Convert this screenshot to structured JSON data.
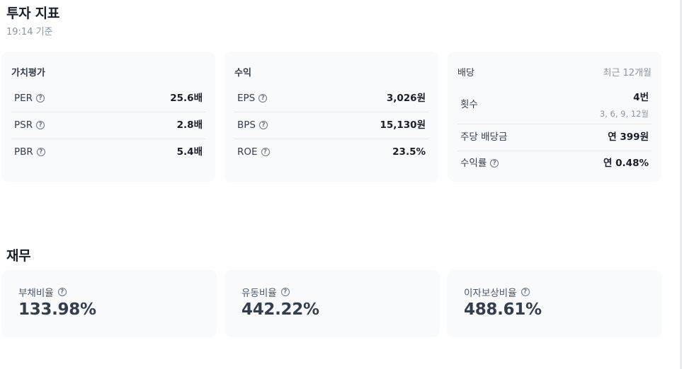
{
  "investment": {
    "title": "투자 지표",
    "timestamp": "19:14 기준"
  },
  "valuation": {
    "title": "가치평가",
    "rows": [
      {
        "label": "PER",
        "value": "25.6배"
      },
      {
        "label": "PSR",
        "value": "2.8배"
      },
      {
        "label": "PBR",
        "value": "5.4배"
      }
    ]
  },
  "profit": {
    "title": "수익",
    "rows": [
      {
        "label": "EPS",
        "value": "3,026원"
      },
      {
        "label": "BPS",
        "value": "15,130원"
      },
      {
        "label": "ROE",
        "value": "23.5%"
      }
    ]
  },
  "dividend": {
    "title": "배당",
    "period": "최근 12개월",
    "rows": [
      {
        "label": "횟수",
        "value": "4번",
        "sub": "3, 6, 9, 12월"
      },
      {
        "label": "주당 배당금",
        "value": "연 399원"
      },
      {
        "label": "수익률",
        "value": "연 0.48%"
      }
    ]
  },
  "finance": {
    "title": "재무",
    "cards": [
      {
        "label": "부채비율",
        "value": "133.98%"
      },
      {
        "label": "유동비율",
        "value": "442.22%"
      },
      {
        "label": "이자보상비율",
        "value": "488.61%"
      }
    ]
  },
  "icons": {
    "help": "question-circle-icon"
  }
}
